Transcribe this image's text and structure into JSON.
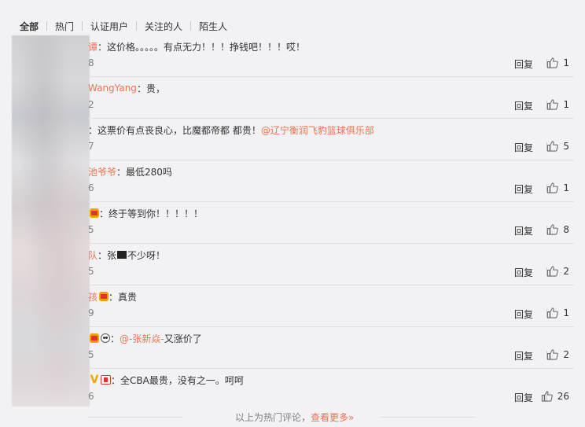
{
  "tabs": [
    "全部",
    "热门",
    "认证用户",
    "关注的人",
    "陌生人"
  ],
  "active_tab": 0,
  "comments": [
    {
      "name": "谭",
      "badges": [],
      "text": "这价格。。。。。有点无力！！！挣钱吧！！！哎！",
      "mention": "",
      "time": "8",
      "reply": "回复",
      "likes": "1"
    },
    {
      "name": "WangYang",
      "badges": [],
      "text": "贵，",
      "mention": "",
      "time": "2",
      "reply": "回复",
      "likes": "1"
    },
    {
      "name": "",
      "badges": [],
      "text": "这票价有点丧良心，比魔都帝都 都贵！",
      "mention": "@辽宁衡润飞豹篮球俱乐部",
      "time": "7",
      "reply": "回复",
      "likes": "5"
    },
    {
      "name": "池爷爷",
      "badges": [],
      "text": "最低280吗",
      "mention": "",
      "time": "6",
      "reply": "回复",
      "likes": "1"
    },
    {
      "name": "",
      "badges": [
        "crown"
      ],
      "text": "终于等到你！！！！！",
      "mention": "",
      "time": "5",
      "reply": "回复",
      "likes": "8"
    },
    {
      "name": "队",
      "badges": [],
      "text_before": "张",
      "text": "不少呀！",
      "mention": "",
      "censor": true,
      "time": "5",
      "reply": "回复",
      "likes": "2"
    },
    {
      "name": "孩",
      "badges": [
        "crown"
      ],
      "text": "真贵",
      "mention": "",
      "time": "9",
      "reply": "回复",
      "likes": "1"
    },
    {
      "name": "",
      "badges": [
        "crown",
        "panda"
      ],
      "text": "又涨价了",
      "mention": "@-张新焱-",
      "mention_first": true,
      "time": "5",
      "reply": "回复",
      "likes": "2"
    },
    {
      "name": "",
      "badges": [
        "v",
        "vip"
      ],
      "text": "全CBA最贵，没有之一。呵呵",
      "mention": "",
      "time": "6",
      "reply": "回复",
      "likes": "26"
    }
  ],
  "footer": {
    "text": "以上为热门评论，",
    "more": "查看更多»"
  }
}
